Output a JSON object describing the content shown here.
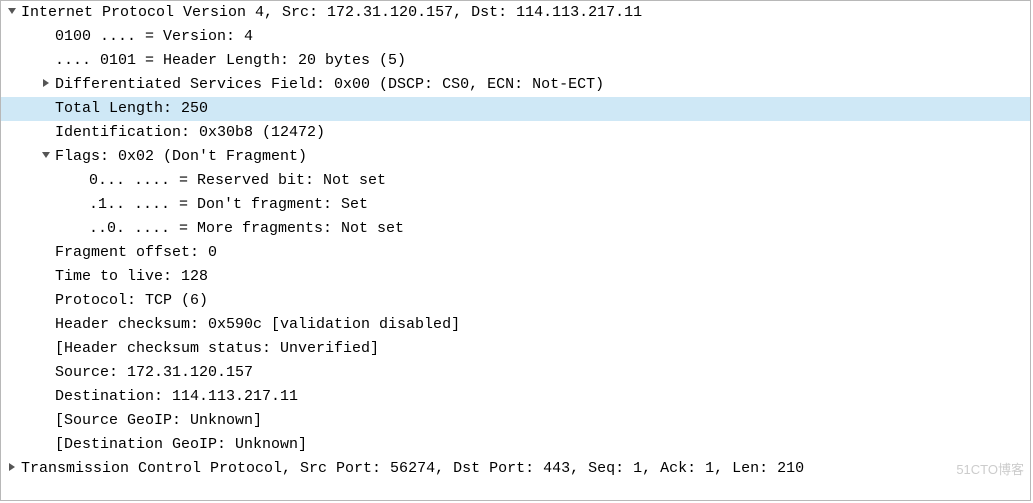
{
  "rows": [
    {
      "indent": 0,
      "arrow": "down",
      "text": "Internet Protocol Version 4, Src: 172.31.120.157, Dst: 114.113.217.11",
      "sel": false,
      "int": true,
      "name": "ipv4-header-row"
    },
    {
      "indent": 1,
      "arrow": "",
      "text": "0100 .... = Version: 4",
      "sel": false,
      "int": true,
      "name": "ip-version-row"
    },
    {
      "indent": 1,
      "arrow": "",
      "text": ".... 0101 = Header Length: 20 bytes (5)",
      "sel": false,
      "int": true,
      "name": "ip-header-length-row"
    },
    {
      "indent": 1,
      "arrow": "right",
      "text": "Differentiated Services Field: 0x00 (DSCP: CS0, ECN: Not-ECT)",
      "sel": false,
      "int": true,
      "name": "dsf-row"
    },
    {
      "indent": 1,
      "arrow": "",
      "text": "Total Length: 250",
      "sel": true,
      "int": true,
      "name": "total-length-row"
    },
    {
      "indent": 1,
      "arrow": "",
      "text": "Identification: 0x30b8 (12472)",
      "sel": false,
      "int": true,
      "name": "identification-row"
    },
    {
      "indent": 1,
      "arrow": "down",
      "text": "Flags: 0x02 (Don't Fragment)",
      "sel": false,
      "int": true,
      "name": "flags-row"
    },
    {
      "indent": 2,
      "arrow": "",
      "text": "0... .... = Reserved bit: Not set",
      "sel": false,
      "int": true,
      "name": "reserved-bit-row"
    },
    {
      "indent": 2,
      "arrow": "",
      "text": ".1.. .... = Don't fragment: Set",
      "sel": false,
      "int": true,
      "name": "dont-fragment-row"
    },
    {
      "indent": 2,
      "arrow": "",
      "text": "..0. .... = More fragments: Not set",
      "sel": false,
      "int": true,
      "name": "more-fragments-row"
    },
    {
      "indent": 1,
      "arrow": "",
      "text": "Fragment offset: 0",
      "sel": false,
      "int": true,
      "name": "fragment-offset-row"
    },
    {
      "indent": 1,
      "arrow": "",
      "text": "Time to live: 128",
      "sel": false,
      "int": true,
      "name": "ttl-row"
    },
    {
      "indent": 1,
      "arrow": "",
      "text": "Protocol: TCP (6)",
      "sel": false,
      "int": true,
      "name": "protocol-row"
    },
    {
      "indent": 1,
      "arrow": "",
      "text": "Header checksum: 0x590c [validation disabled]",
      "sel": false,
      "int": true,
      "name": "checksum-row"
    },
    {
      "indent": 1,
      "arrow": "",
      "text": "[Header checksum status: Unverified]",
      "sel": false,
      "int": true,
      "name": "checksum-status-row"
    },
    {
      "indent": 1,
      "arrow": "",
      "text": "Source: 172.31.120.157",
      "sel": false,
      "int": true,
      "name": "source-addr-row"
    },
    {
      "indent": 1,
      "arrow": "",
      "text": "Destination: 114.113.217.11",
      "sel": false,
      "int": true,
      "name": "destination-addr-row"
    },
    {
      "indent": 1,
      "arrow": "",
      "text": "[Source GeoIP: Unknown]",
      "sel": false,
      "int": true,
      "name": "source-geoip-row"
    },
    {
      "indent": 1,
      "arrow": "",
      "text": "[Destination GeoIP: Unknown]",
      "sel": false,
      "int": true,
      "name": "destination-geoip-row"
    },
    {
      "indent": 0,
      "arrow": "right",
      "text": "Transmission Control Protocol, Src Port: 56274, Dst Port: 443, Seq: 1, Ack: 1, Len: 210",
      "sel": false,
      "int": true,
      "name": "tcp-header-row"
    }
  ],
  "watermark": "51CTO博客"
}
